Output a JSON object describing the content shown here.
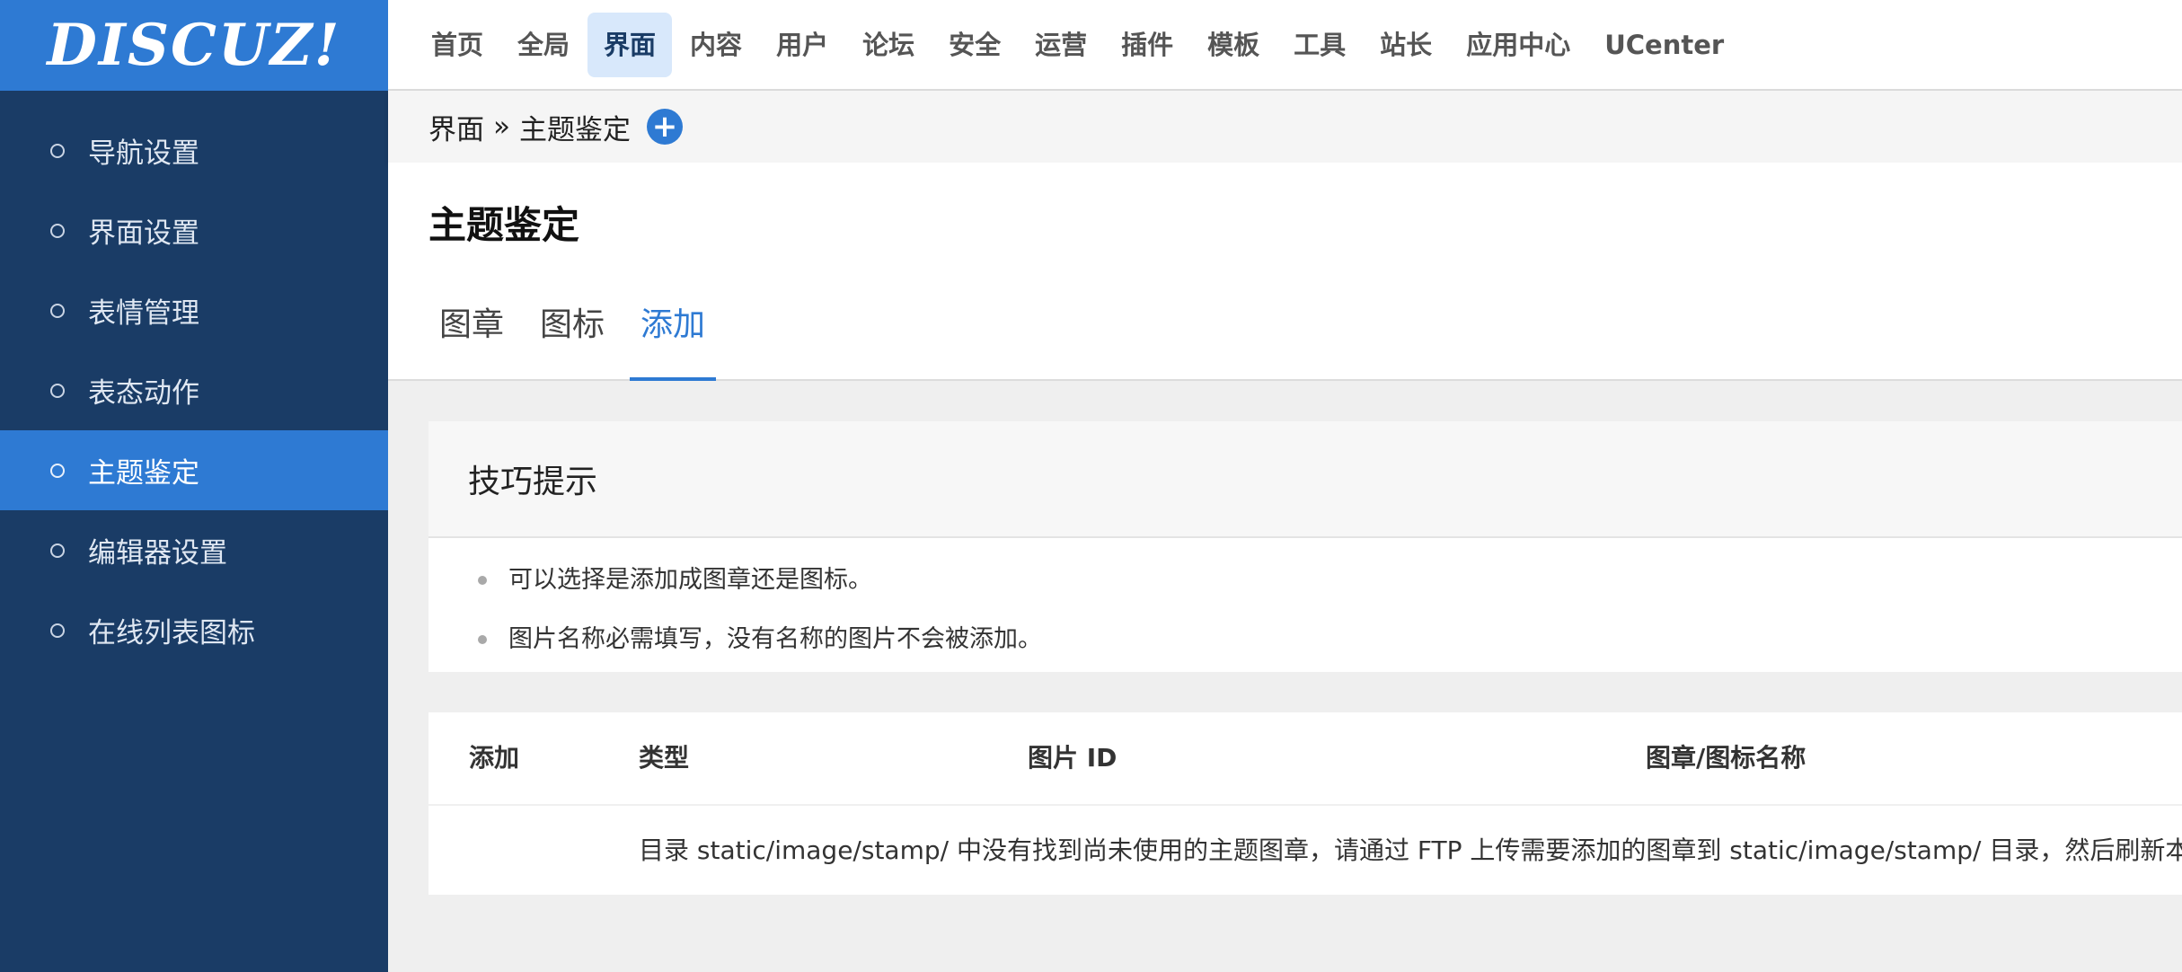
{
  "app": {
    "logo_text": "DISCUZ!"
  },
  "topnav": {
    "items": [
      "首页",
      "全局",
      "界面",
      "内容",
      "用户",
      "论坛",
      "安全",
      "运营",
      "插件",
      "模板",
      "工具",
      "站长",
      "应用中心",
      "UCenter"
    ],
    "active_index": 2
  },
  "sidebar": {
    "items": [
      "导航设置",
      "界面设置",
      "表情管理",
      "表态动作",
      "主题鉴定",
      "编辑器设置",
      "在线列表图标"
    ],
    "active_index": 4
  },
  "breadcrumb": {
    "parent": "界面",
    "separator": "»",
    "current": "主题鉴定",
    "add_icon": "plus-circle-icon"
  },
  "page": {
    "title": "主题鉴定"
  },
  "tabs": {
    "items": [
      "图章",
      "图标",
      "添加"
    ],
    "active_index": 2
  },
  "tips": {
    "title": "技巧提示",
    "items": [
      "可以选择是添加成图章还是图标。",
      "图片名称必需填写，没有名称的图片不会被添加。"
    ]
  },
  "table": {
    "headers": [
      "添加",
      "类型",
      "图片 ID",
      "图章/图标名称"
    ],
    "empty_message": "目录 static/image/stamp/ 中没有找到尚未使用的主题图章，请通过 FTP 上传需要添加的图章到 static/image/stamp/ 目录，然后刷新本页"
  },
  "colors": {
    "sidebar_bg": "#1a3c66",
    "accent": "#2e7ad3",
    "nav_active_bg": "#d8e8fb"
  }
}
